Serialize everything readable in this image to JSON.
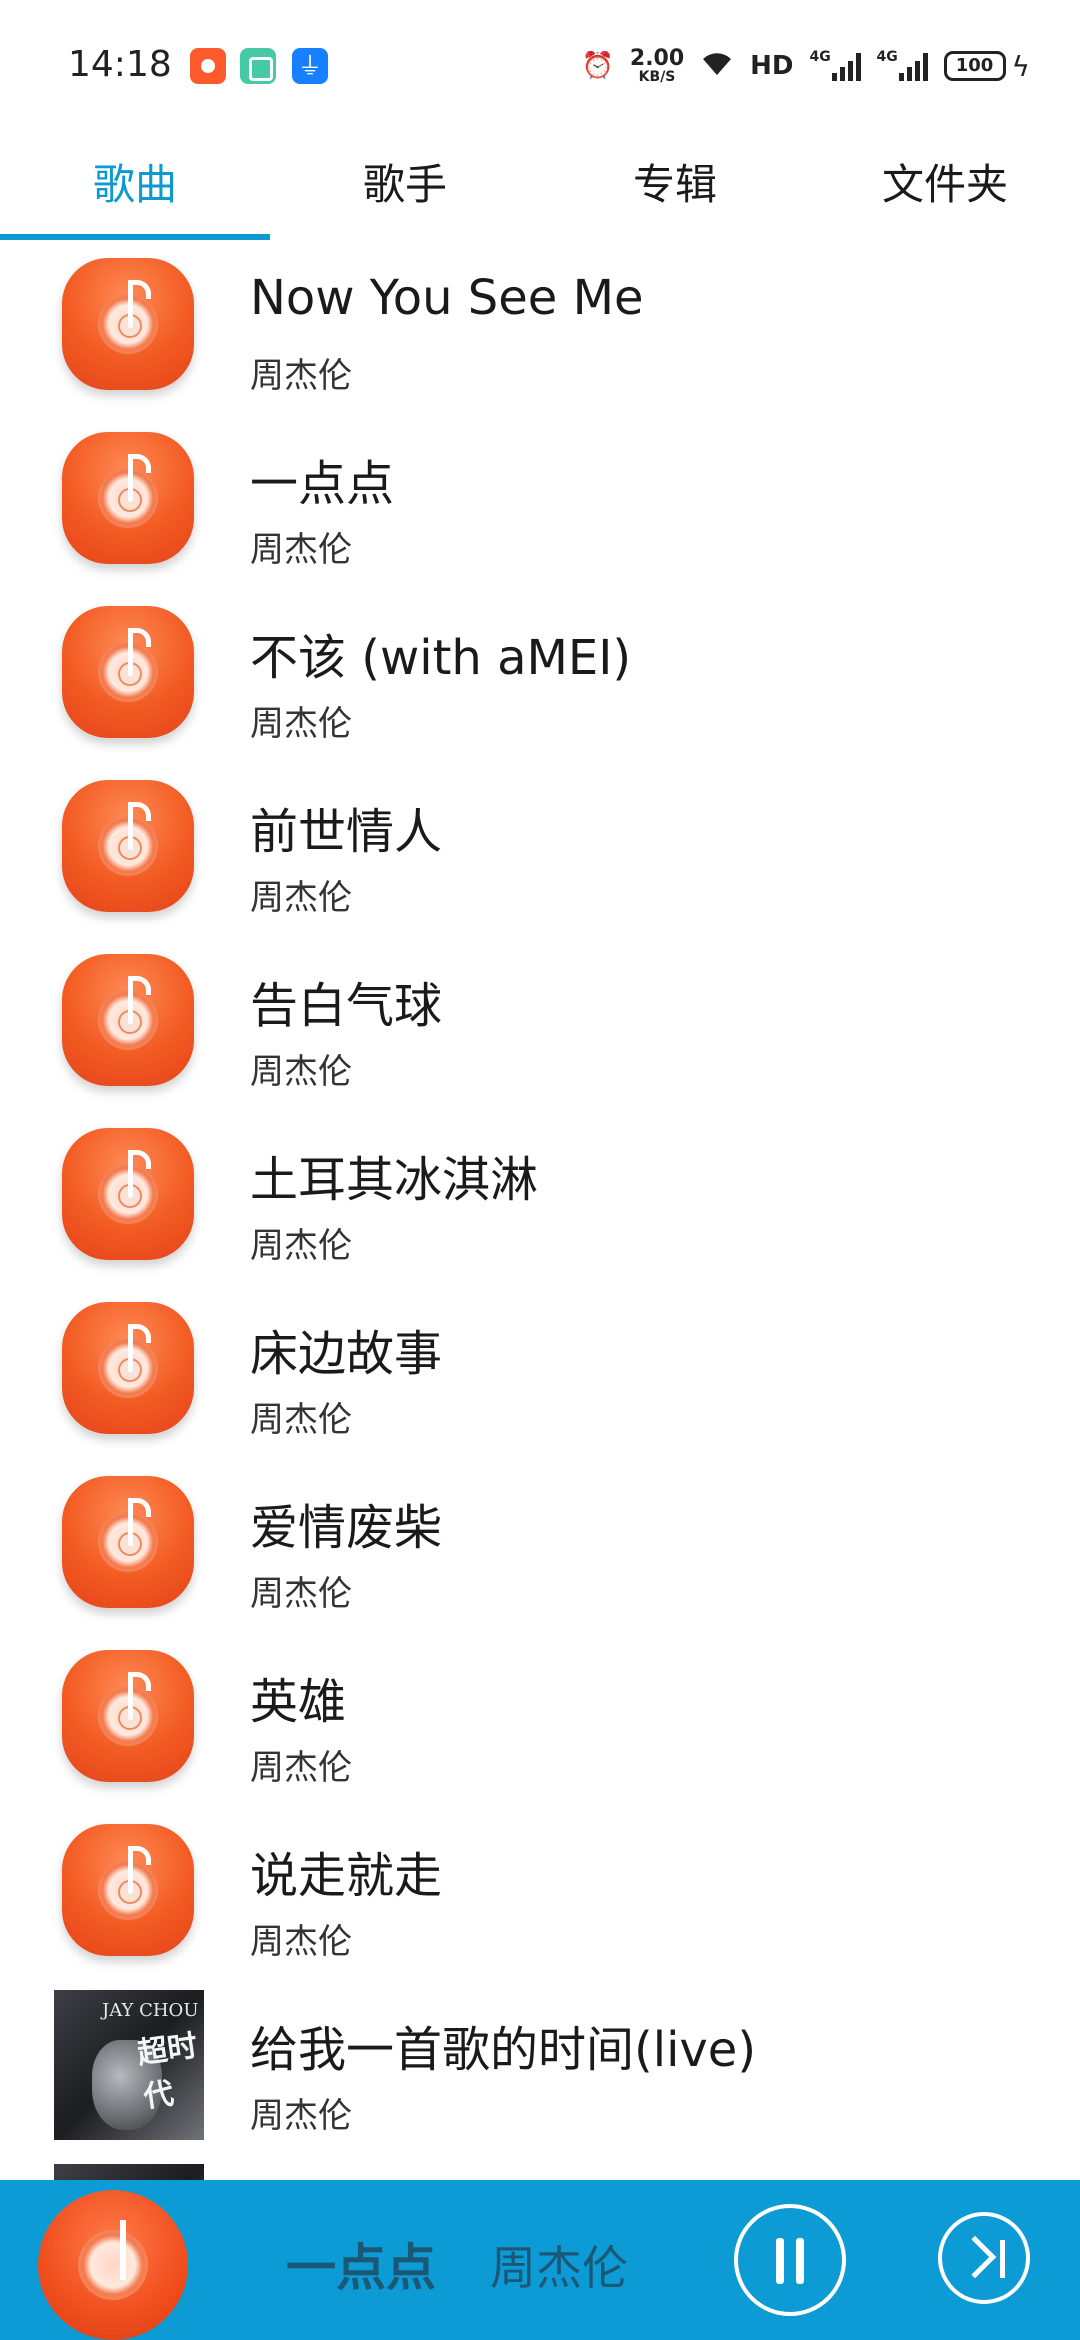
{
  "status_bar": {
    "time": "14:18",
    "speed_value": "2.00",
    "speed_unit": "KB/S",
    "network": "HD",
    "signal_1": "4G",
    "signal_2": "4G",
    "battery": "100",
    "icons": [
      "notification-app-icon",
      "notification-app-icon",
      "usb-icon",
      "alarm-icon",
      "wifi-icon",
      "charging-icon"
    ]
  },
  "tabs": [
    {
      "label": "歌曲",
      "active": true
    },
    {
      "label": "歌手",
      "active": false
    },
    {
      "label": "专辑",
      "active": false
    },
    {
      "label": "文件夹",
      "active": false
    }
  ],
  "songs": [
    {
      "title": "Now You See Me",
      "artist": "周杰伦"
    },
    {
      "title": "一点点",
      "artist": "周杰伦"
    },
    {
      "title": "不该 (with aMEI)",
      "artist": "周杰伦"
    },
    {
      "title": "前世情人",
      "artist": "周杰伦"
    },
    {
      "title": "告白气球",
      "artist": "周杰伦"
    },
    {
      "title": "土耳其冰淇淋",
      "artist": "周杰伦"
    },
    {
      "title": "床边故事",
      "artist": "周杰伦"
    },
    {
      "title": "爱情废柴",
      "artist": "周杰伦"
    },
    {
      "title": "英雄",
      "artist": "周杰伦"
    },
    {
      "title": "说走就走",
      "artist": "周杰伦"
    },
    {
      "title": "给我一首歌的时间(live)",
      "artist": "周杰伦"
    }
  ],
  "album_art_text": {
    "brand": "JAY CHOU",
    "title": "超时代"
  },
  "player": {
    "title": "一点点",
    "artist": "周杰伦"
  },
  "colors": {
    "accent": "#0e9ad1",
    "player_bg": "#0d9bd6",
    "icon_orange": "#f25b22"
  }
}
